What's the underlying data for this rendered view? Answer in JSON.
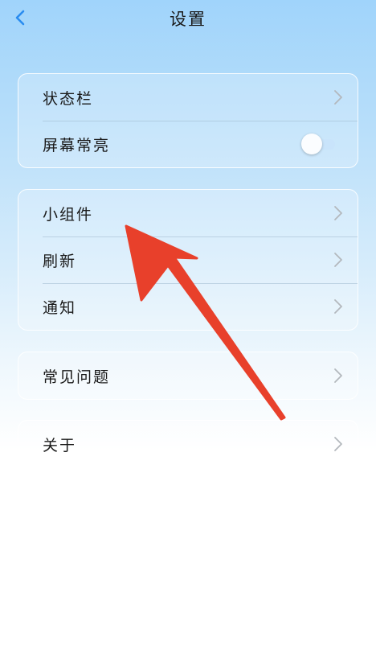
{
  "header": {
    "title": "设置",
    "back_icon": "chevron-left-icon"
  },
  "groups": [
    {
      "items": [
        {
          "label": "状态栏",
          "control": "chevron"
        },
        {
          "label": "屏幕常亮",
          "control": "toggle",
          "toggle_on": false
        }
      ]
    },
    {
      "items": [
        {
          "label": "小组件",
          "control": "chevron"
        },
        {
          "label": "刷新",
          "control": "chevron"
        },
        {
          "label": "通知",
          "control": "chevron"
        }
      ]
    },
    {
      "items": [
        {
          "label": "常见问题",
          "control": "chevron"
        }
      ]
    },
    {
      "items": [
        {
          "label": "关于",
          "control": "chevron"
        }
      ]
    }
  ],
  "annotation": {
    "type": "arrow",
    "color": "#e8402b",
    "points_to": "小组件"
  },
  "colors": {
    "accent": "#2a8cf0",
    "chevron": "#b3b8bd",
    "toggle_track": "#c9e4fb"
  }
}
